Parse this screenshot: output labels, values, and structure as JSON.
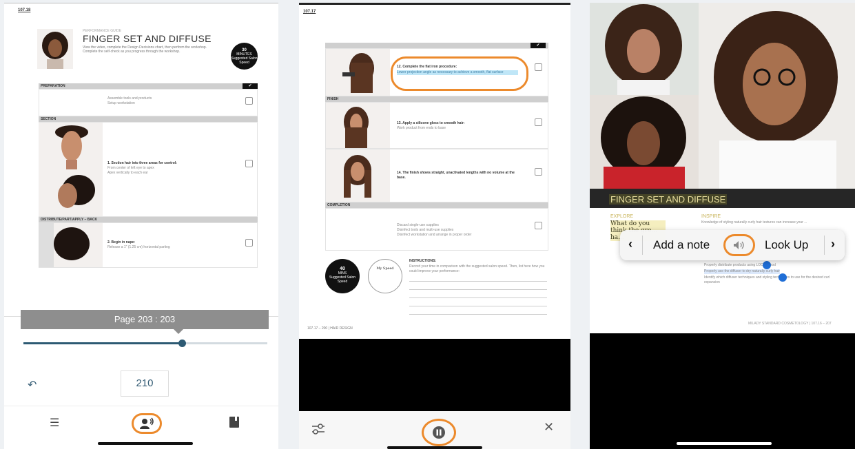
{
  "panel1": {
    "page_id": "107.18",
    "guide_label": "PERFORMANCE GUIDE",
    "title": "FINGER SET AND DIFFUSE",
    "description": "View the video, complete the Design Decisions chart, then perform the workshop. Complete the self-check as you progress through the workshop.",
    "badge": {
      "value": "30",
      "unit": "MINUTES",
      "caption": "Suggested Salon Speed"
    },
    "checkmark": "✔",
    "sections": [
      {
        "header": "PREPARATION"
      },
      {
        "header": "SECTION"
      },
      {
        "header": "DISTRIBUTE/PART/APPLY – BACK"
      }
    ],
    "steps": [
      {
        "title": "",
        "bullets": [
          "Assemble tools and products",
          "Setup workstation"
        ]
      },
      {
        "title": "1.   Section hair into three areas for control:",
        "bullets": [
          "From center of left eye to apex",
          "Apex vertically to each ear"
        ]
      },
      {
        "title": "2.   Begin in nape:",
        "bullets": [
          "Release a 1\" (1.25 cm) horizontal parting"
        ]
      }
    ],
    "slider_tooltip": "Page 203 : 203",
    "slider_fraction": 0.65,
    "page_input": "210",
    "icons": {
      "undo": "undo-icon",
      "toc": "list-icon",
      "read_aloud": "read-aloud-icon",
      "bookmark": "bookmark-icon"
    }
  },
  "panel2": {
    "page_id": "107.17",
    "checkmark": "✔",
    "sections": [
      {
        "header": ""
      },
      {
        "header": "FINISH"
      },
      {
        "header": "COMPLETION"
      }
    ],
    "steps": [
      {
        "title": "12.  Complete the flat iron procedure:",
        "bullets": [
          "Lower projection angle as necessary to achieve a smooth, flat surface"
        ]
      },
      {
        "title": "13.  Apply a silicone gloss to smooth hair:",
        "bullets": [
          "Work product from ends to base"
        ]
      },
      {
        "title": "14.  The finish shows straight, unactivated lengths with no volume at the base.",
        "bullets": []
      },
      {
        "title": "",
        "bullets": [
          "Discard single-use supplies",
          "Disinfect tools and multi-use supplies",
          "Disinfect workstation and arrange in proper order"
        ]
      }
    ],
    "speed_badge": {
      "value": "40",
      "unit": "MINS",
      "caption": "Suggested Salon Speed"
    },
    "my_speed": "My Speed",
    "instructions_title": "INSTRUCTIONS:",
    "instructions_text": "Record your time in comparison with the suggested salon speed. Then, list here how you could improve your performance:",
    "footer": "107.17 – 200  |  HAIR DESIGN",
    "icons": {
      "settings": "sliders-icon",
      "pause": "pause-icon",
      "close": "close-icon"
    }
  },
  "panel3": {
    "title": "FINGER SET AND DIFFUSE",
    "explore_label": "EXPLORE",
    "explore_question": "What do you think the gre... ha...",
    "inspire_label": "INSPIRE",
    "inspire_text": "Knowledge of styling naturally curly hair textures can increase your ...",
    "menu": {
      "prev": "‹",
      "add_note": "Add a note",
      "look_up": "Look Up",
      "next": "›"
    },
    "bullets": [
      "Properly distribute products using LOC method",
      "Properly use the diffuser to dry naturally curly hair",
      "Identify which diffuser techniques and styling techniques to use for the desired curl expansion"
    ],
    "footer": "MILADY STANDARD COSMETOLOGY  |  107.16 – 207",
    "colors": {
      "highlight": "#e9df9f",
      "handle": "#1f6ed6",
      "accent": "#ec8a2c"
    },
    "icons": {
      "speaker": "speaker-icon"
    }
  }
}
